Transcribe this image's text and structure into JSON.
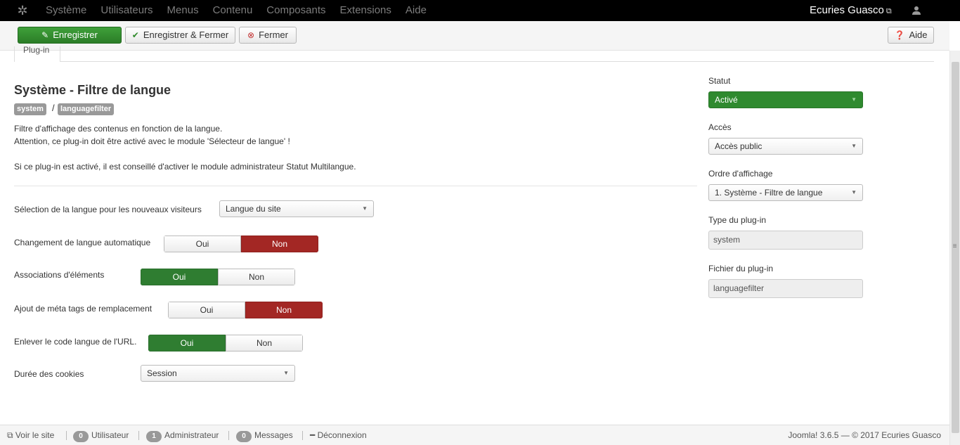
{
  "navbar": {
    "logo_icon": "joomla-logo-icon",
    "menu": [
      "Système",
      "Utilisateurs",
      "Menus",
      "Contenu",
      "Composants",
      "Extensions",
      "Aide"
    ],
    "site_name": "Ecuries Guasco",
    "site_icon": "external-link-icon",
    "user_icon": "user-icon"
  },
  "toolbar": {
    "save": "Enregistrer",
    "save_close": "Enregistrer & Fermer",
    "close": "Fermer",
    "help": "Aide"
  },
  "tab": {
    "label": "Plug-in"
  },
  "plugin": {
    "title": "Système - Filtre de langue",
    "badge_group": "system",
    "badge_sep": "/",
    "badge_element": "languagefilter",
    "desc_line1": "Filtre d'affichage des contenus en fonction de la langue.",
    "desc_line2": "Attention, ce plug-in doit être activé avec le module 'Sélecteur de langue' !",
    "desc_line3": "Si ce plug-in est activé, il est conseillé d'activer le module administrateur Statut Multilangue."
  },
  "form": {
    "lang_select_label": "Sélection de la langue pour les nouveaux visiteurs",
    "lang_select_value": "Langue du site",
    "auto_change_label": "Changement de langue automatique",
    "associations_label": "Associations d'éléments",
    "meta_tags_label": "Ajout de méta tags de remplacement",
    "remove_code_label": "Enlever le code langue de l'URL.",
    "cookie_label": "Durée des cookies",
    "cookie_value": "Session",
    "yes": "Oui",
    "no": "Non"
  },
  "sidebar": {
    "status_label": "Statut",
    "status_value": "Activé",
    "access_label": "Accès",
    "access_value": "Accès public",
    "order_label": "Ordre d'affichage",
    "order_value": "1. Système - Filtre de langue",
    "type_label": "Type du plug-in",
    "type_value": "system",
    "file_label": "Fichier du plug-in",
    "file_value": "languagefilter"
  },
  "footer": {
    "view_site": "Voir le site",
    "users_count": "0",
    "users_label": "Utilisateur",
    "admins_count": "1",
    "admins_label": "Administrateur",
    "messages_count": "0",
    "messages_label": "Messages",
    "logout": "Déconnexion",
    "copyright": "Joomla! 3.6.5 — © 2017 Ecuries Guasco"
  },
  "colors": {
    "green": "#2f7d31",
    "red": "#a32724",
    "navbar": "#000000"
  }
}
